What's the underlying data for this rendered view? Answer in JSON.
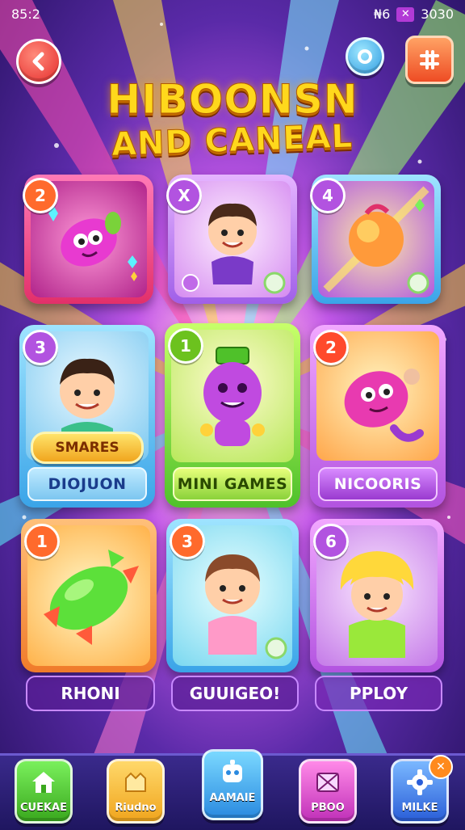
{
  "status_bar": {
    "time": "85:2",
    "indicator": "₦6",
    "signal_glyph": "✕",
    "battery": "3030"
  },
  "header": {
    "back_icon": "arrow-left-icon",
    "profile_icon": "ring-icon",
    "menu_icon": "grid-icon"
  },
  "title": {
    "line1": "HIBOONSN",
    "line2": "AND CANEAL"
  },
  "cards": [
    {
      "badge": "2",
      "badge_color": "#ff6a2c",
      "frame": "pink",
      "art": "pink-gem-character"
    },
    {
      "badge": "X",
      "badge_color": "#b253e0",
      "frame": "purple",
      "art": "boy-character"
    },
    {
      "badge": "4",
      "badge_color": "#b253e0",
      "frame": "blue",
      "art": "fruit-orb"
    },
    {
      "badge": "3",
      "badge_color": "#b253e0",
      "frame": "blue",
      "art": "boy-with-sign",
      "sticker": "SMARES",
      "label": "DIOJUON"
    },
    {
      "badge": "1",
      "badge_color": "#6cc21e",
      "frame": "green",
      "art": "purple-robot",
      "label": "MINI GAMES"
    },
    {
      "badge": "2",
      "badge_color": "#ff4a2c",
      "frame": "orange",
      "art": "pink-creature",
      "label": "NICOORIS"
    },
    {
      "badge": "1",
      "badge_color": "#ff6a2c",
      "frame": "orange",
      "art": "green-candy",
      "label": "RHONI"
    },
    {
      "badge": "3",
      "badge_color": "#ff6a2c",
      "frame": "blue",
      "art": "girl-character",
      "label": "GUUIGEO!"
    },
    {
      "badge": "6",
      "badge_color": "#b253e0",
      "frame": "violet",
      "art": "blonde-character",
      "label": "PPLOY"
    }
  ],
  "nav": [
    {
      "label": "CUEKAE",
      "icon": "home-icon",
      "color": "#4fc12a"
    },
    {
      "label": "Riudno",
      "icon": "star-icon",
      "color": "#f0a51e"
    },
    {
      "label": "AAMAIE",
      "icon": "robot-icon",
      "color": "#3aa4e8"
    },
    {
      "label": "PBOO",
      "icon": "envelope-icon",
      "color": "#d040c8"
    },
    {
      "label": "MILKE",
      "icon": "gear-icon",
      "color": "#3a7fe0",
      "notification": "✕"
    }
  ]
}
